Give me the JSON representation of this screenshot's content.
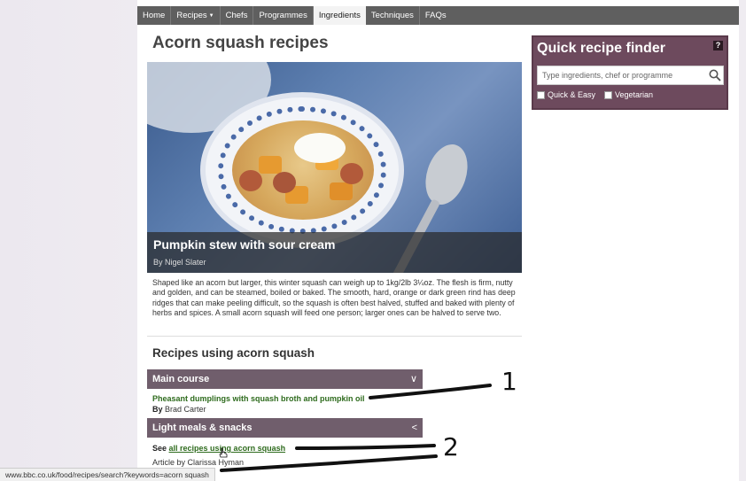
{
  "nav": {
    "items": [
      {
        "label": "Home"
      },
      {
        "label": "Recipes",
        "caret": "▼"
      },
      {
        "label": "Chefs"
      },
      {
        "label": "Programmes"
      },
      {
        "label": "Ingredients",
        "active": true
      },
      {
        "label": "Techniques"
      },
      {
        "label": "FAQs"
      }
    ]
  },
  "page": {
    "title": "Acorn squash recipes"
  },
  "hero": {
    "title": "Pumpkin stew with sour cream",
    "author": "By Nigel Slater"
  },
  "description": "Shaped like an acorn but larger, this winter squash can weigh up to 1kg/2lb 3¼oz. The flesh is firm, nutty and golden, and can be steamed, boiled or baked. The smooth, hard, orange or dark green rind has deep ridges that can make peeling difficult, so the squash is often best halved, stuffed and baked with plenty of herbs and spices. A small acorn squash will feed one person; larger ones can be halved to serve two.",
  "recipes_section": {
    "title": "Recipes using acorn squash",
    "categories": [
      {
        "label": "Main course",
        "chevron": "∨",
        "recipe": "Pheasant dumplings with squash broth and pumpkin oil",
        "by_prefix": "By",
        "by_name": "Brad Carter"
      },
      {
        "label": "Light meals & snacks",
        "chevron": "<",
        "see_prefix": "See",
        "see_link": "all recipes using acorn squash",
        "article": "Article by Clarissa Hyman"
      }
    ]
  },
  "finder": {
    "title": "Quick recipe finder",
    "help": "?",
    "placeholder": "Type ingredients, chef or programme",
    "options": [
      {
        "label": "Quick & Easy"
      },
      {
        "label": "Vegetarian"
      }
    ]
  },
  "status_bar": "www.bbc.co.uk/food/recipes/search?keywords=acorn squash",
  "annotations": [
    "1",
    "2"
  ],
  "icons": {
    "search": "magnifier-icon",
    "cursor": "hand-cursor-icon"
  },
  "colors": {
    "nav": "#5f5f5f",
    "category_bar": "#705e6c",
    "finder": "#6d4a5d",
    "link": "#2e6b1d"
  }
}
